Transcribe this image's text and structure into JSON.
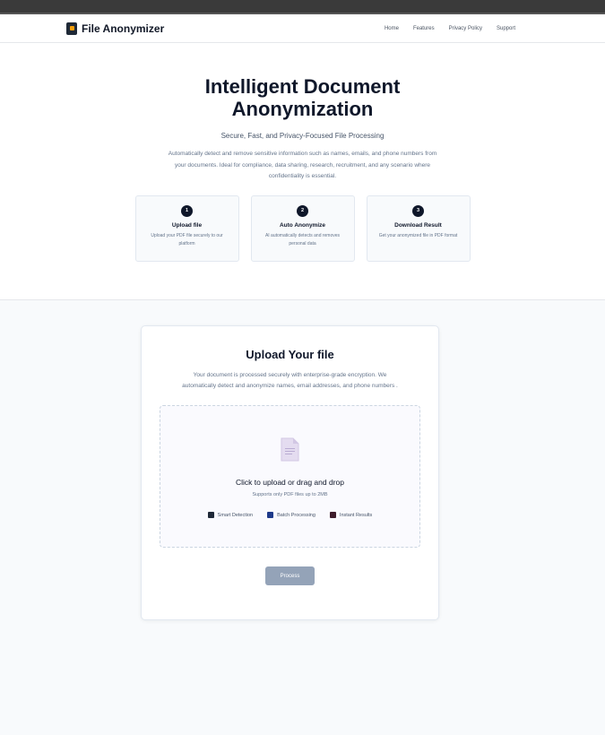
{
  "header": {
    "brand": "File Anonymizer",
    "nav": [
      "Home",
      "Features",
      "Privacy Policy",
      "Support"
    ]
  },
  "hero": {
    "title_line1": "Intelligent Document",
    "title_line2": "Anonymization",
    "subtitle": "Secure, Fast, and Privacy-Focused File Processing",
    "description": "Automatically detect and remove sensitive information such as names, emails, and phone numbers from your documents. Ideal for compliance, data sharing, research, recruitment, and any scenario where confidentiality is essential.",
    "steps": [
      {
        "num": "1",
        "title": "Upload file",
        "desc": "Upload your PDF file securely to our platform"
      },
      {
        "num": "2",
        "title": "Auto Anonymize",
        "desc": "AI automatically detects and removes personal data"
      },
      {
        "num": "3",
        "title": "Download Result",
        "desc": "Get your anonymized file in PDF format"
      }
    ]
  },
  "upload": {
    "title": "Upload Your file",
    "description": "Your document is processed securely with enterprise-grade encryption. We automatically detect and anonymize names, email addresses, and phone numbers .",
    "dropzone_title": "Click to upload or drag and drop",
    "dropzone_sub": "Supports only PDF files up to 2MB",
    "features": [
      {
        "label": "Smart Detection",
        "icon": "ai-icon",
        "color": "#1f2937"
      },
      {
        "label": "Batch Processing",
        "icon": "batch-icon",
        "color": "#1e3a8a"
      },
      {
        "label": "Instant Results",
        "icon": "bolt-icon",
        "color": "#3f1d2b"
      }
    ],
    "process_label": "Process"
  },
  "colors": {
    "accent": "#0f172a",
    "button_disabled": "#94a3b8",
    "doc_icon": "#d8cfe8"
  }
}
